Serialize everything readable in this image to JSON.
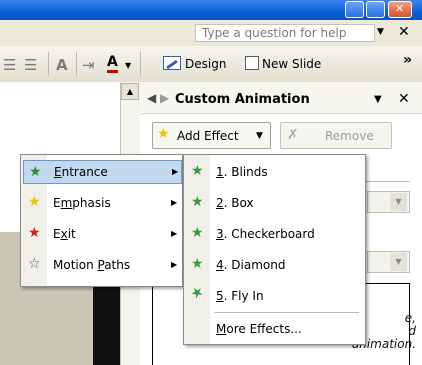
{
  "title_bar": {
    "minimize_icon": "minimize-icon",
    "maximize_icon": "maximize-icon",
    "close_icon": "close-icon"
  },
  "help": {
    "placeholder": "Type a question for help"
  },
  "toolbar": {
    "design_label": "Design",
    "design_underline": "e",
    "new_slide_label": "New Slide",
    "new_slide_underline": "N",
    "more_glyph": "»"
  },
  "task_pane": {
    "title": "Custom Animation",
    "add_effect_label": "Add Effect",
    "remove_label": "Remove",
    "list_text": [
      "e,",
      "d",
      "animation."
    ]
  },
  "effect_menu": {
    "items": [
      {
        "label_pre": "",
        "label_u": "E",
        "label_post": "ntrance",
        "star_color": "#2a8a2a",
        "has_submenu": true,
        "highlighted": true
      },
      {
        "label_pre": "E",
        "label_u": "m",
        "label_post": "phasis",
        "star_color": "#e8c800",
        "has_submenu": true,
        "highlighted": false
      },
      {
        "label_pre": "E",
        "label_u": "x",
        "label_post": "it",
        "star_color": "#d22020",
        "has_submenu": true,
        "highlighted": false
      },
      {
        "label_pre": "Motion ",
        "label_u": "P",
        "label_post": "aths",
        "star_color": "#ffffff",
        "has_submenu": true,
        "highlighted": false
      }
    ]
  },
  "entrance_submenu": {
    "items": [
      {
        "num": "1",
        "label": ". Blinds"
      },
      {
        "num": "2",
        "label": ". Box"
      },
      {
        "num": "3",
        "label": ". Checkerboard"
      },
      {
        "num": "4",
        "label": ". Diamond"
      },
      {
        "num": "5",
        "label": ". Fly In"
      }
    ],
    "more_effects_u": "M",
    "more_effects_rest": "ore Effects..."
  },
  "colors": {
    "highlight": "#c2d8ef",
    "menu_border": "#8a8a8a",
    "title_blue": "#0a5fd6"
  }
}
